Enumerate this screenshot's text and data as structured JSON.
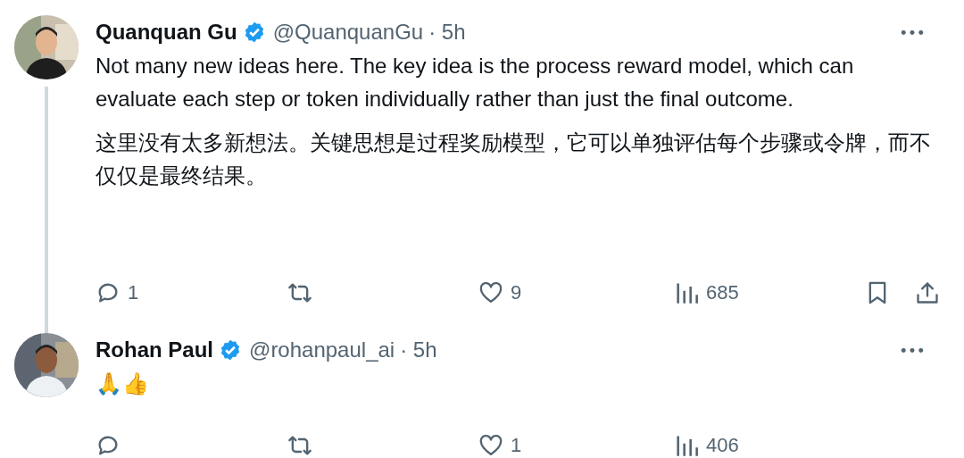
{
  "tweets": [
    {
      "name": "Quanquan Gu",
      "verified": true,
      "handle": "@QuanquanGu",
      "time": "· 5h",
      "thread_continues": true,
      "paragraphs": [
        "Not many new ideas here. The key idea is the process reward model, which can evaluate each step or token individually rather than just the final outcome.",
        "这里没有太多新想法。关键思想是过程奖励模型，它可以单独评估每个步骤或令牌，而不仅仅是最终结果。"
      ],
      "actions": [
        {
          "kind": "reply",
          "count": "1"
        },
        {
          "kind": "repost"
        },
        {
          "kind": "like",
          "count": "9"
        },
        {
          "kind": "views",
          "count": "685"
        },
        {
          "kind": "bookmark"
        },
        {
          "kind": "share"
        }
      ]
    },
    {
      "name": "Rohan Paul",
      "verified": true,
      "handle": "@rohanpaul_ai",
      "time": "· 5h",
      "thread_continues": false,
      "paragraphs": [
        "🙏👍"
      ],
      "actions": [
        {
          "kind": "reply"
        },
        {
          "kind": "repost"
        },
        {
          "kind": "like",
          "count": "1"
        },
        {
          "kind": "views",
          "count": "406"
        }
      ]
    }
  ]
}
